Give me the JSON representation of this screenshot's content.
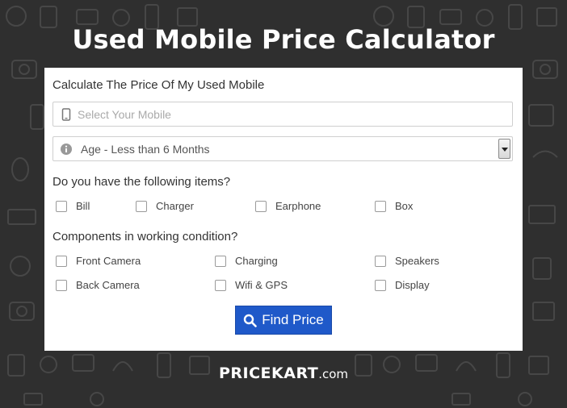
{
  "page_title": "Used Mobile Price Calculator",
  "card": {
    "heading": "Calculate The Price Of My Used Mobile",
    "mobile_select": {
      "placeholder": "Select Your Mobile",
      "icon": "mobile-phone-icon"
    },
    "age_select": {
      "selected": "Age - Less than 6 Months",
      "icon": "info-icon"
    }
  },
  "items_section": {
    "title": "Do you have the following items?",
    "options": [
      "Bill",
      "Charger",
      "Earphone",
      "Box"
    ]
  },
  "components_section": {
    "title": "Components in working condition?",
    "options": [
      "Front Camera",
      "Charging",
      "Speakers",
      "Back Camera",
      "Wifi & GPS",
      "Display"
    ]
  },
  "find_button": {
    "label": "Find Price",
    "icon": "search-icon",
    "color": "#1f59c9"
  },
  "brand": {
    "name": "PRICEKART",
    "suffix": ".com"
  }
}
